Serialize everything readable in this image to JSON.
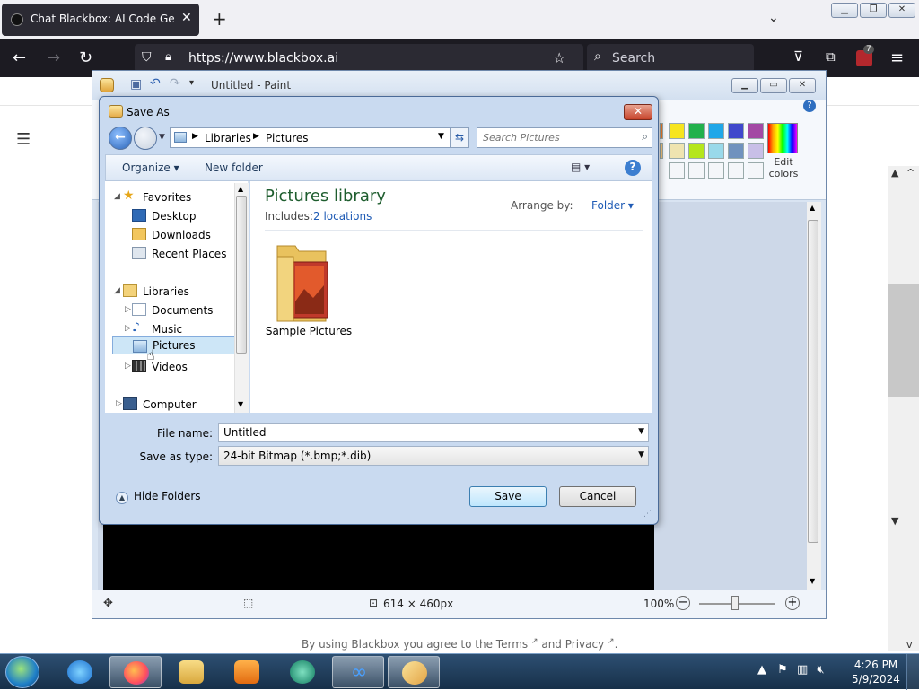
{
  "browser": {
    "tab_title": "Chat Blackbox: AI Code Genera",
    "url": "https://www.blackbox.ai",
    "search_placeholder": "Search",
    "notification_count": "7"
  },
  "page": {
    "footer_prefix": "By using Blackbox you agree to the Terms",
    "footer_mid": "and Privacy",
    "footer_suffix": "."
  },
  "paint": {
    "title": "Untitled - Paint",
    "edit_colors_line1": "Edit",
    "edit_colors_line2": "colors",
    "dimensions": "614 × 460px",
    "zoom": "100%"
  },
  "palette": {
    "row1": [
      "#f7e51f",
      "#22b14c",
      "#1fa7e8",
      "#3f48cc",
      "#a349a4"
    ],
    "row2": [
      "#efe4b0",
      "#b5e61d",
      "#99d9ea",
      "#7092be",
      "#c8bfe7"
    ],
    "edge1": "#f07a2a",
    "edge2": "#f4c27a"
  },
  "dialog": {
    "title": "Save As",
    "close": "✕",
    "crumb_libraries": "Libraries",
    "crumb_pictures": "Pictures",
    "search_placeholder": "Search Pictures",
    "organize": "Organize ▾",
    "new_folder": "New folder",
    "nav": {
      "favorites": "Favorites",
      "desktop": "Desktop",
      "downloads": "Downloads",
      "recent_places": "Recent Places",
      "libraries": "Libraries",
      "documents": "Documents",
      "music": "Music",
      "pictures": "Pictures",
      "videos": "Videos",
      "computer": "Computer"
    },
    "library_title": "Pictures library",
    "includes_label": "Includes:",
    "includes_link": "2 locations",
    "arrange_label": "Arrange by:",
    "arrange_value": "Folder ▾",
    "folder_item": "Sample Pictures",
    "file_name_label": "File name:",
    "file_name_value": "Untitled",
    "save_type_label": "Save as type:",
    "save_type_value": "24-bit Bitmap (*.bmp;*.dib)",
    "hide_folders": "Hide Folders",
    "save": "Save",
    "cancel": "Cancel"
  },
  "taskbar": {
    "time": "4:26 PM",
    "date": "5/9/2024"
  }
}
